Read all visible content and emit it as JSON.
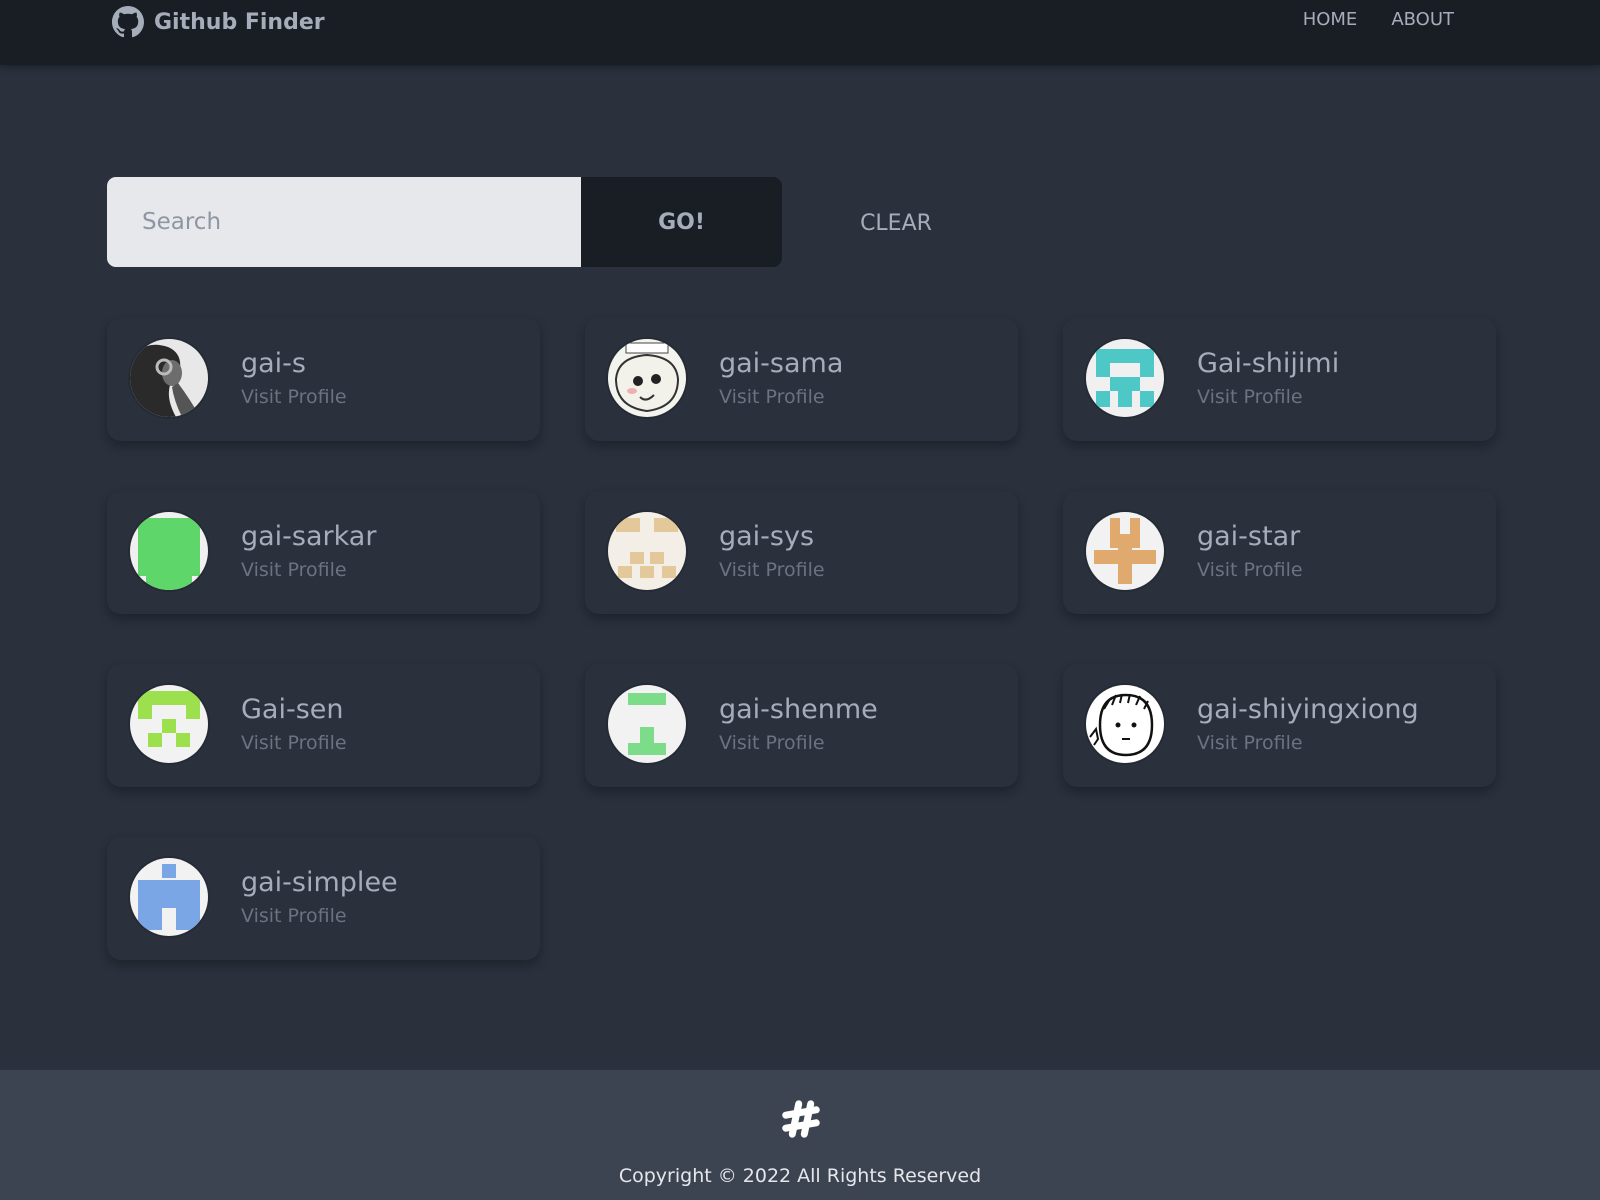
{
  "app": {
    "title": "Github Finder",
    "logo_icon": "github-icon"
  },
  "nav": {
    "links": [
      "HOME",
      "ABOUT"
    ]
  },
  "search": {
    "placeholder": "Search",
    "value": "",
    "go_label": "GO!",
    "clear_label": "CLEAR"
  },
  "users": [
    {
      "login": "gai-s",
      "link_label": "Visit Profile",
      "avatar": "portrait-headphones"
    },
    {
      "login": "gai-sama",
      "link_label": "Visit Profile",
      "avatar": "meme-face"
    },
    {
      "login": "Gai-shijimi",
      "link_label": "Visit Profile",
      "avatar": "identicon-teal"
    },
    {
      "login": "gai-sarkar",
      "link_label": "Visit Profile",
      "avatar": "identicon-green"
    },
    {
      "login": "gai-sys",
      "link_label": "Visit Profile",
      "avatar": "identicon-tan"
    },
    {
      "login": "gai-star",
      "link_label": "Visit Profile",
      "avatar": "identicon-orange"
    },
    {
      "login": "Gai-sen",
      "link_label": "Visit Profile",
      "avatar": "identicon-lime"
    },
    {
      "login": "gai-shenme",
      "link_label": "Visit Profile",
      "avatar": "identicon-mint"
    },
    {
      "login": "gai-shiyingxiong",
      "link_label": "Visit Profile",
      "avatar": "cartoon-face"
    },
    {
      "login": "gai-simplee",
      "link_label": "Visit Profile",
      "avatar": "identicon-blue"
    }
  ],
  "footer": {
    "icon": "hash-icon",
    "copyright": "Copyright © 2022 All Rights Reserved"
  },
  "colors": {
    "page_bg": "#2a303c",
    "navbar_bg": "#191d24",
    "footer_bg": "#3d4451",
    "text": "#a6adba",
    "muted": "#6b7280"
  }
}
